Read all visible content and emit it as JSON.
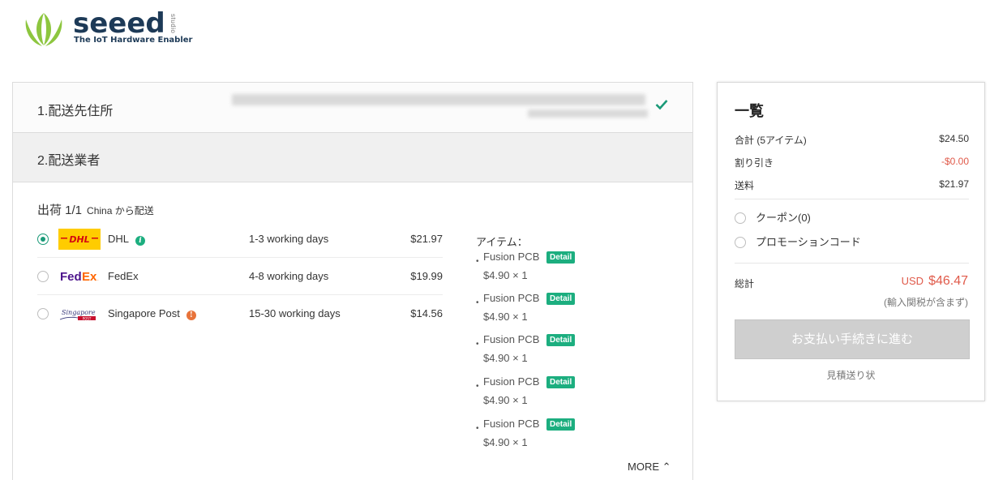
{
  "brand": {
    "name": "seeed",
    "tagline": "The IoT Hardware Enabler",
    "sub": "studio",
    "colors": {
      "green": "#8dc63f",
      "navy": "#1d3a57"
    }
  },
  "steps": [
    {
      "label": "1.配送先住所",
      "status_icon": "check-icon",
      "completed": true
    },
    {
      "label": "2.配送業者"
    }
  ],
  "shipment": {
    "title": "出荷 1/1",
    "origin": "China から配送"
  },
  "carriers": [
    {
      "name": "DHL",
      "days": "1-3 working days",
      "price": "$21.97",
      "selected": true,
      "info_icon": "info-icon",
      "info_color": "#1cae7f"
    },
    {
      "name": "FedEx",
      "days": "4-8 working days",
      "price": "$19.99",
      "selected": false
    },
    {
      "name": "Singapore Post",
      "days": "15-30 working days",
      "price": "$14.56",
      "selected": false,
      "info_icon": "alert-icon",
      "info_color": "#e8733a"
    }
  ],
  "items_label": "アイテム：",
  "items": [
    {
      "name": "Fusion PCB",
      "badge": "Detail",
      "qty": "$4.90 × 1"
    },
    {
      "name": "Fusion PCB",
      "badge": "Detail",
      "qty": "$4.90 × 1"
    },
    {
      "name": "Fusion PCB",
      "badge": "Detail",
      "qty": "$4.90 × 1"
    },
    {
      "name": "Fusion PCB",
      "badge": "Detail",
      "qty": "$4.90 × 1"
    },
    {
      "name": "Fusion PCB",
      "badge": "Detail",
      "qty": "$4.90 × 1"
    }
  ],
  "more_label": "MORE ⌃",
  "summary": {
    "title": "一覧",
    "subtotal_label": "合計 (5アイテム)",
    "subtotal": "$24.50",
    "discount_label": "割り引き",
    "discount": "-$0.00",
    "shipping_label": "送料",
    "shipping": "$21.97",
    "coupon_label": "クーポン(0)",
    "promo_label": "プロモーションコード",
    "total_label": "総計",
    "currency": "USD",
    "total": "$46.47",
    "tax_note": "(輸入関税が含まず)",
    "checkout_label": "お支払い手続きに進む",
    "quote_label": "見積送り状",
    "accent_color": "#e05a4a"
  }
}
